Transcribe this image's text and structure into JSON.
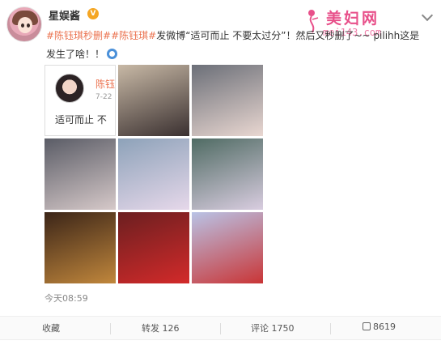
{
  "post": {
    "author": "星娱酱",
    "verified_badge": "V",
    "text_parts": [
      "#陈钰琪秒删#",
      "#陈钰琪#",
      "发微博“适可而止 不要太过分”！然后又秒删了~~ ",
      "pilihh",
      "这是发生了啥！！"
    ],
    "timestamp": "今天08:59"
  },
  "watermark": {
    "title": "美妇网",
    "url": "mei143.com"
  },
  "embedded_screenshot": {
    "name": "陈钰",
    "date": "7-22",
    "text": "适可而止 不"
  },
  "gallery": [
    {
      "name": "gallery-photo-screenshot",
      "desc": "screenshot of deleted post"
    },
    {
      "name": "gallery-photo-2",
      "colors": [
        "#c8b9a6",
        "#3a3030"
      ]
    },
    {
      "name": "gallery-photo-3",
      "colors": [
        "#6b6f78",
        "#e9d7d1"
      ]
    },
    {
      "name": "gallery-photo-4",
      "colors": [
        "#5a5c66",
        "#d6c9c9"
      ]
    },
    {
      "name": "gallery-photo-5",
      "colors": [
        "#8da2b9",
        "#e6d8ea"
      ]
    },
    {
      "name": "gallery-photo-6",
      "colors": [
        "#4f6b63",
        "#d9cde0"
      ]
    },
    {
      "name": "gallery-photo-7",
      "colors": [
        "#3b2518",
        "#c1873c"
      ]
    },
    {
      "name": "gallery-photo-8",
      "colors": [
        "#6b1f20",
        "#d32a2a"
      ]
    },
    {
      "name": "gallery-photo-9",
      "colors": [
        "#b9c3e6",
        "#c93536"
      ]
    }
  ],
  "actions": {
    "collect": "收藏",
    "repost": "转发 126",
    "comment": "评论 1750",
    "like": "8619"
  },
  "colors": {
    "tag": "#eb7350",
    "watermark": "#e8508a",
    "badge": "#f5a623"
  }
}
